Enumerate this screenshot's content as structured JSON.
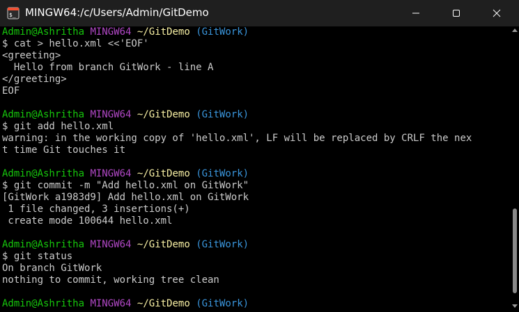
{
  "window": {
    "title": "MINGW64:/c/Users/Admin/GitDemo",
    "app_icon": "git-bash-icon",
    "controls": [
      "minimize-icon",
      "maximize-icon",
      "close-icon"
    ]
  },
  "terminal": {
    "prompt": {
      "user": "Admin@Ashritha",
      "host": "MINGW64",
      "path": "~/GitDemo",
      "branch": "(GitWork)"
    },
    "lines": {
      "l0": "",
      "l1": "$ cat > hello.xml <<'EOF'",
      "l2": "<greeting>",
      "l3": "  Hello from branch GitWork - line A",
      "l4": "</greeting>",
      "l5": "EOF",
      "l6": "",
      "l7": "",
      "l8": "$ git add hello.xml",
      "l9": "warning: in the working copy of 'hello.xml', LF will be replaced by CRLF the nex",
      "l10": "t time Git touches it",
      "l11": "",
      "l12": "",
      "l13": "$ git commit -m \"Add hello.xml on GitWork\"",
      "l14": "[GitWork a1983d9] Add hello.xml on GitWork",
      "l15": " 1 file changed, 3 insertions(+)",
      "l16": " create mode 100644 hello.xml",
      "l17": "",
      "l18": "",
      "l19": "$ git status",
      "l20": "On branch GitWork",
      "l21": "nothing to commit, working tree clean",
      "l22": "",
      "l23": ""
    }
  },
  "colors": {
    "user": "#16c60c",
    "host": "#b148c6",
    "path": "#f9f1a5",
    "branch": "#3a96dd",
    "text": "#cccccc",
    "background": "#000000"
  }
}
